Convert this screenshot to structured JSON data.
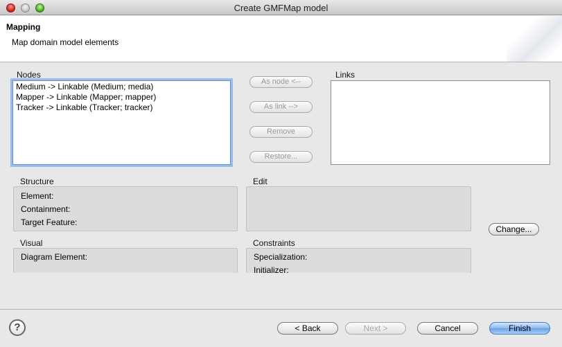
{
  "window": {
    "title": "Create GMFMap model"
  },
  "header": {
    "title": "Mapping",
    "description": "Map domain model elements"
  },
  "nodes": {
    "label": "Nodes",
    "items": [
      "Medium -> Linkable (Medium; media)",
      "Mapper -> Linkable (Mapper; mapper)",
      "Tracker -> Linkable (Tracker; tracker)"
    ]
  },
  "links": {
    "label": "Links"
  },
  "actions": {
    "as_node": "As node <--",
    "as_link": "As link -->",
    "remove": "Remove",
    "restore": "Restore..."
  },
  "structure": {
    "label": "Structure",
    "element": "Element:",
    "containment": "Containment:",
    "target_feature": "Target Feature:"
  },
  "edit": {
    "label": "Edit"
  },
  "change_button": "Change...",
  "visual": {
    "label": "Visual",
    "diagram_element": "Diagram Element:"
  },
  "constraints": {
    "label": "Constraints",
    "specialization": "Specialization:",
    "initializer": "Initializer:"
  },
  "footer": {
    "help_glyph": "?",
    "back": "< Back",
    "next": "Next >",
    "cancel": "Cancel",
    "finish": "Finish"
  }
}
